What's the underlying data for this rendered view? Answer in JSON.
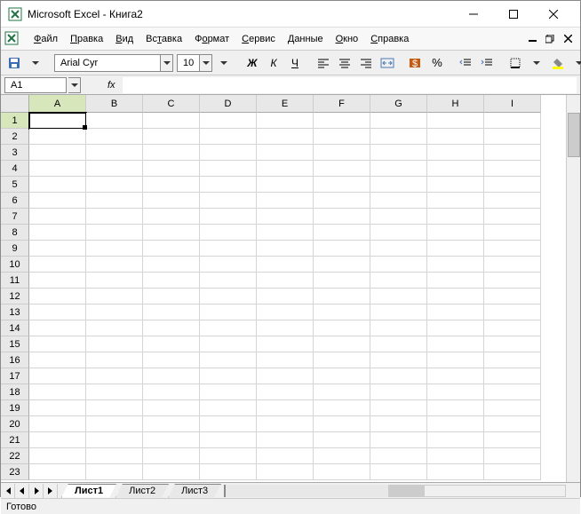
{
  "titlebar": {
    "title": "Microsoft Excel - Книга2"
  },
  "menu": {
    "items": [
      "Файл",
      "Правка",
      "Вид",
      "Вставка",
      "Формат",
      "Сервис",
      "Данные",
      "Окно",
      "Справка"
    ],
    "underline_idx": [
      0,
      0,
      0,
      2,
      1,
      0,
      0,
      0,
      0
    ]
  },
  "toolbar": {
    "font_name": "Arial Cyr",
    "font_size": "10",
    "bold": "Ж",
    "italic": "К",
    "underline": "Ч",
    "percent": "%"
  },
  "formulabar": {
    "namebox": "A1",
    "fx": "fx",
    "value": ""
  },
  "grid": {
    "columns": [
      "A",
      "B",
      "C",
      "D",
      "E",
      "F",
      "G",
      "H",
      "I"
    ],
    "rows": [
      "1",
      "2",
      "3",
      "4",
      "5",
      "6",
      "7",
      "8",
      "9",
      "10",
      "11",
      "12",
      "13",
      "14",
      "15",
      "16",
      "17",
      "18",
      "19",
      "20",
      "21",
      "22",
      "23"
    ],
    "active_col": 0,
    "active_row": 0
  },
  "sheets": {
    "tabs": [
      "Лист1",
      "Лист2",
      "Лист3"
    ],
    "active": 0
  },
  "statusbar": {
    "text": "Готово"
  }
}
